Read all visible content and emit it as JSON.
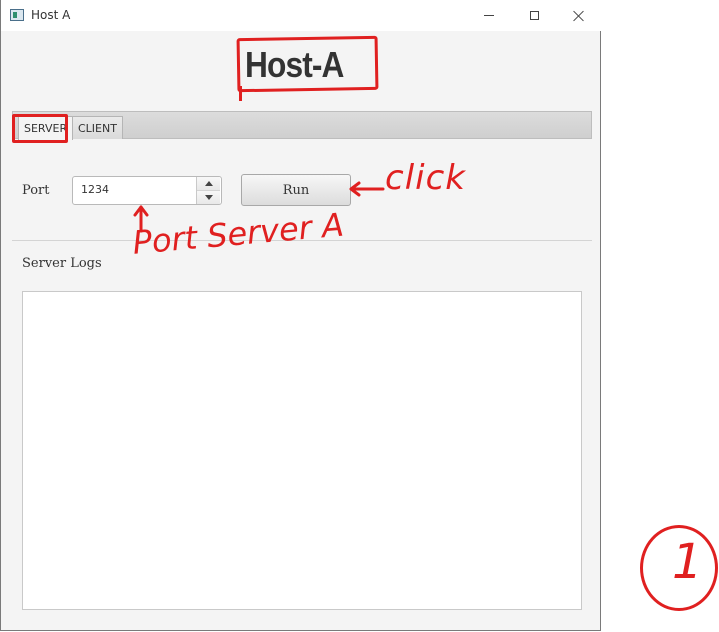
{
  "window": {
    "title": "Host A",
    "icon": "app-window-icon",
    "controls": [
      "minimize-icon",
      "maximize-icon",
      "close-icon"
    ]
  },
  "header": {
    "title": "Host-A"
  },
  "tabs": [
    {
      "label": "SERVER",
      "selected": true
    },
    {
      "label": "CLIENT",
      "selected": false
    }
  ],
  "server": {
    "port_label": "Port",
    "port_value": "1234",
    "run_label": "Run",
    "logs_label": "Server Logs",
    "logs_text": ""
  },
  "annotations": {
    "click_note": "click",
    "port_note": "Port Server A",
    "step_number": "1",
    "color": "#e02020"
  },
  "colors": {
    "window_bg": "#f4f4f4",
    "titlebar_bg": "#ffffff",
    "text": "#333333"
  }
}
